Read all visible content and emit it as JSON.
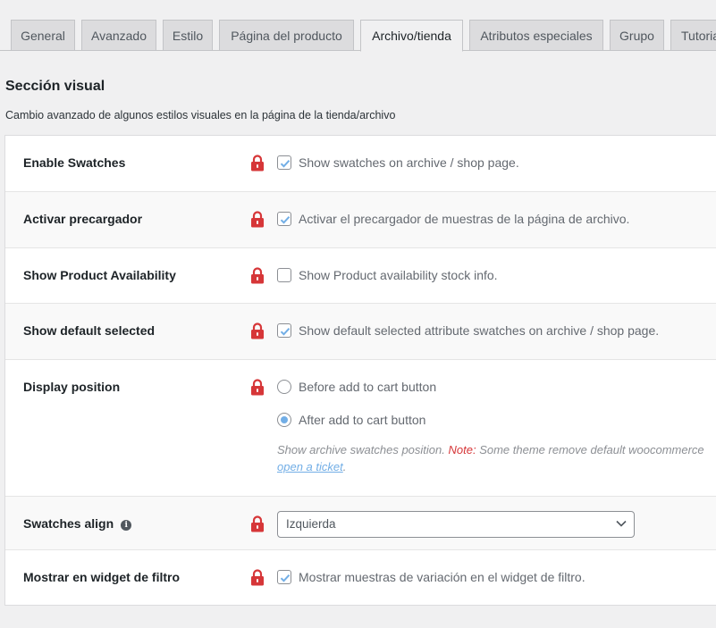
{
  "tabs": [
    {
      "label": "General"
    },
    {
      "label": "Avanzado"
    },
    {
      "label": "Estilo"
    },
    {
      "label": "Página del producto"
    },
    {
      "label": "Archivo/tienda"
    },
    {
      "label": "Atributos especiales"
    },
    {
      "label": "Grupo"
    },
    {
      "label": "Tutoria"
    }
  ],
  "active_tab": "Archivo/tienda",
  "section": {
    "title": "Sección visual",
    "description": "Cambio avanzado de algunos estilos visuales en la página de la tienda/archivo"
  },
  "settings": {
    "enable_swatches": {
      "label": "Enable Swatches",
      "option": "Show swatches on archive / shop page.",
      "checked": true
    },
    "preloader": {
      "label": "Activar precargador",
      "option": "Activar el precargador de muestras de la página de archivo.",
      "checked": true
    },
    "availability": {
      "label": "Show Product Availability",
      "option": "Show Product availability stock info.",
      "checked": false
    },
    "default_selected": {
      "label": "Show default selected",
      "option": "Show default selected attribute swatches on archive / shop page.",
      "checked": true
    },
    "display_position": {
      "label": "Display position",
      "options": [
        "Before add to cart button",
        "After add to cart button"
      ],
      "selected": "After add to cart button",
      "help": "Show archive swatches position.",
      "note_label": "Note:",
      "note_text": "Some theme remove default woocommerce",
      "link": "open a ticket",
      "link_suffix": "."
    },
    "swatches_align": {
      "label": "Swatches align",
      "info_icon": "i",
      "value": "Izquierda"
    },
    "filter_widget": {
      "label": "Mostrar en widget de filtro",
      "option": "Mostrar muestras de variación en el widget de filtro.",
      "checked": true
    }
  },
  "colors": {
    "lock": "#d63638",
    "checkbox_mark": "#72aee6",
    "note": "#d63638",
    "link": "#72aee6"
  }
}
